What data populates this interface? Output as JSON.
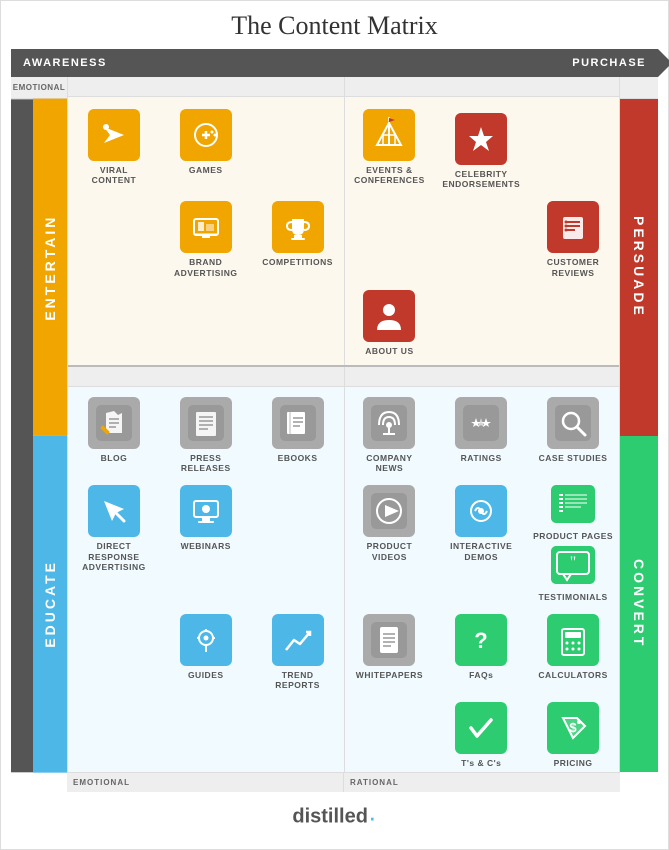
{
  "title": "The Content Matrix",
  "axes": {
    "top_left": "AWARENESS",
    "top_right": "PURCHASE",
    "left_top": "EMOTIONAL",
    "left_bottom": "RATIONAL",
    "left_section_top": "ENTERTAIN",
    "left_section_bottom": "EDUCATE",
    "right_section_top": "PERSUADE",
    "right_section_bottom": "CONVERT"
  },
  "entertain_items": [
    {
      "id": "viral-content",
      "label": "VIRAL\nCONTENT",
      "icon": "📣",
      "color": "orange",
      "col": 1,
      "row": 1
    },
    {
      "id": "games",
      "label": "GAMES",
      "icon": "🎮",
      "color": "orange",
      "col": 2,
      "row": 1
    },
    {
      "id": "events-conferences",
      "label": "EVENTS &\nCONFERENCES",
      "icon": "🎪",
      "color": "orange",
      "col": 3,
      "row": 1
    },
    {
      "id": "celebrity-endorsements",
      "label": "CELEBRITY\nENDORSEMENTS",
      "icon": "⭐",
      "color": "red",
      "col": 5,
      "row": 1
    },
    {
      "id": "brand-advertising",
      "label": "BRAND\nADVERTISING",
      "icon": "📺",
      "color": "orange",
      "col": 2,
      "row": 2
    },
    {
      "id": "competitions",
      "label": "COMPETITIONS",
      "icon": "🏆",
      "color": "orange",
      "col": 3,
      "row": 2
    },
    {
      "id": "customer-reviews",
      "label": "CUSTOMER\nREVIEWS",
      "icon": "📋",
      "color": "red",
      "col": 6,
      "row": 2
    },
    {
      "id": "about-us",
      "label": "ABOUT US",
      "icon": "👤",
      "color": "red",
      "col": 4,
      "row": 3
    }
  ],
  "educate_items": [
    {
      "id": "blog",
      "label": "BLOG",
      "icon": "✏️",
      "color": "gray",
      "col": 1,
      "row": 1
    },
    {
      "id": "press-releases",
      "label": "PRESS\nRELEASES",
      "icon": "📰",
      "color": "gray",
      "col": 2,
      "row": 1
    },
    {
      "id": "ebooks",
      "label": "EBOOKS",
      "icon": "📗",
      "color": "gray",
      "col": 3,
      "row": 1
    },
    {
      "id": "company-news",
      "label": "COMPANY\nNEWS",
      "icon": "📡",
      "color": "gray",
      "col": 4,
      "row": 1
    },
    {
      "id": "ratings",
      "label": "RATINGS",
      "icon": "⭐",
      "color": "gray",
      "col": 5,
      "row": 1
    },
    {
      "id": "case-studies",
      "label": "CASE STUDIES",
      "icon": "🔍",
      "color": "gray",
      "col": 6,
      "row": 1
    },
    {
      "id": "direct-response",
      "label": "DIRECT RESPONSE\nADVERTISING",
      "icon": "🔄",
      "color": "blue",
      "col": 1,
      "row": 2
    },
    {
      "id": "webinars",
      "label": "WEBINARS",
      "icon": "👨‍💻",
      "color": "blue",
      "col": 2,
      "row": 2
    },
    {
      "id": "product-videos",
      "label": "PRODUCT\nVIDEOS",
      "icon": "▶️",
      "color": "gray",
      "col": 4,
      "row": 2
    },
    {
      "id": "interactive-demos",
      "label": "INTERACTIVE\nDEMOS",
      "icon": "⚙️",
      "color": "blue",
      "col": 5,
      "row": 2
    },
    {
      "id": "product-pages",
      "label": "PRODUCT PAGES",
      "icon": "|||",
      "color": "green",
      "col": 6,
      "row": 2
    },
    {
      "id": "testimonials",
      "label": "TESTIMONIALS",
      "icon": "💬",
      "color": "green",
      "col": 6,
      "row": 2
    },
    {
      "id": "guides",
      "label": "GUIDES",
      "icon": "🧭",
      "color": "blue",
      "col": 2,
      "row": 3
    },
    {
      "id": "trend-reports",
      "label": "TREND\nREPORTS",
      "icon": "📈",
      "color": "blue",
      "col": 3,
      "row": 3
    },
    {
      "id": "whitepapers",
      "label": "WHITEPAPERS",
      "icon": "📄",
      "color": "gray",
      "col": 4,
      "row": 3
    },
    {
      "id": "faqs",
      "label": "FAQs",
      "icon": "❓",
      "color": "green",
      "col": 5,
      "row": 3
    },
    {
      "id": "calculators",
      "label": "CALCULATORS",
      "icon": "🔢",
      "color": "green",
      "col": 6,
      "row": 3
    },
    {
      "id": "ts-and-cs",
      "label": "T's & C's",
      "icon": "✔️",
      "color": "green",
      "col": 5,
      "row": 4
    },
    {
      "id": "pricing",
      "label": "PRICING",
      "icon": "💲",
      "color": "green",
      "col": 6,
      "row": 4
    }
  ],
  "logo": {
    "text": "distilled",
    "dot": "·"
  }
}
